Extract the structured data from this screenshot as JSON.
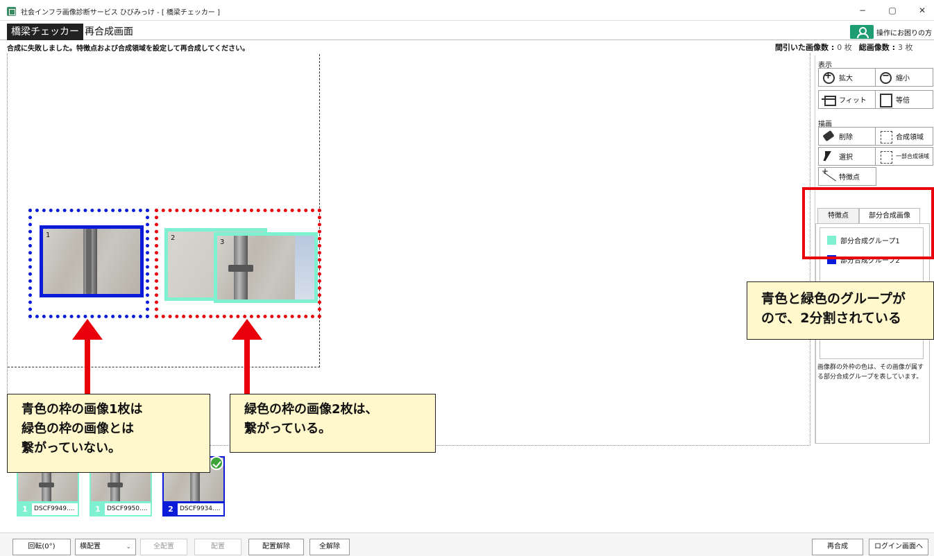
{
  "window": {
    "title": "社会インフラ画像診断サービス ひびみっけ - [ 橋梁チェッカー ]",
    "minimize": "−",
    "restore": "▢",
    "close": "✕"
  },
  "header": {
    "app_name": "橋梁チェッカー",
    "screen_name": "再合成画面",
    "help_label": "操作にお困りの方"
  },
  "status": {
    "message": "合成に失敗しました。特徴点および合成領域を設定して再合成してください。",
    "thinned_label": "間引いた画像数 :",
    "thinned_value": "0 枚",
    "total_label": "総画像数 :",
    "total_value": "3 枚"
  },
  "canvas": {
    "images": [
      {
        "num": "1",
        "frame_color": "#0a1cd8"
      },
      {
        "num": "2",
        "frame_color": "#7ff0d0"
      },
      {
        "num": "3",
        "frame_color": "#7ff0d0"
      }
    ],
    "group_outline_colors": {
      "blue": "#0a1cd8",
      "red": "#e8000b"
    }
  },
  "panel": {
    "display_label": "表示",
    "zoom_in": "拡大",
    "zoom_out": "縮小",
    "fit": "フィット",
    "actual": "等倍",
    "draw_label": "描画",
    "delete": "削除",
    "compose_area": "合成領域",
    "select": "選択",
    "partial_compose_area": "一部合成領域",
    "feature_point": "特徴点",
    "tabs": [
      {
        "label": "特徴点"
      },
      {
        "label": "部分合成画像"
      }
    ],
    "groups": [
      {
        "label": "部分合成グループ1",
        "color": "#7ff0d0"
      },
      {
        "label": "部分合成グループ2",
        "color": "#0a1cd8"
      }
    ],
    "note": "画像群の外枠の色は、その画像が属する部分合成グループを表しています。"
  },
  "thumbnails": [
    {
      "group": "1",
      "name": "DSCF9949....",
      "color": "#7ff0d0"
    },
    {
      "group": "1",
      "name": "DSCF9950....",
      "color": "#7ff0d0"
    },
    {
      "group": "2",
      "name": "DSCF9934....",
      "color": "#0a1cd8"
    }
  ],
  "toolbar": {
    "rotate": "回転(0°)",
    "layout_select": "横配置",
    "chevron": "⌄",
    "place_all": "全配置",
    "place": "配置",
    "unplace": "配置解除",
    "release_all": "全解除",
    "recompose": "再合成",
    "to_login": "ログイン画面へ"
  },
  "annotations": {
    "left": "青色の枠の画像1枚は\n緑色の枠の画像とは\n繋がっていない。",
    "middle": "緑色の枠の画像2枚は、\n繋がっている。",
    "right": "青色と緑色のグループが\nので、2分割されている"
  },
  "colors": {
    "annotation_red": "#e8000b",
    "annotation_bg": "#fff8cc",
    "help_green": "#1e9d73"
  }
}
